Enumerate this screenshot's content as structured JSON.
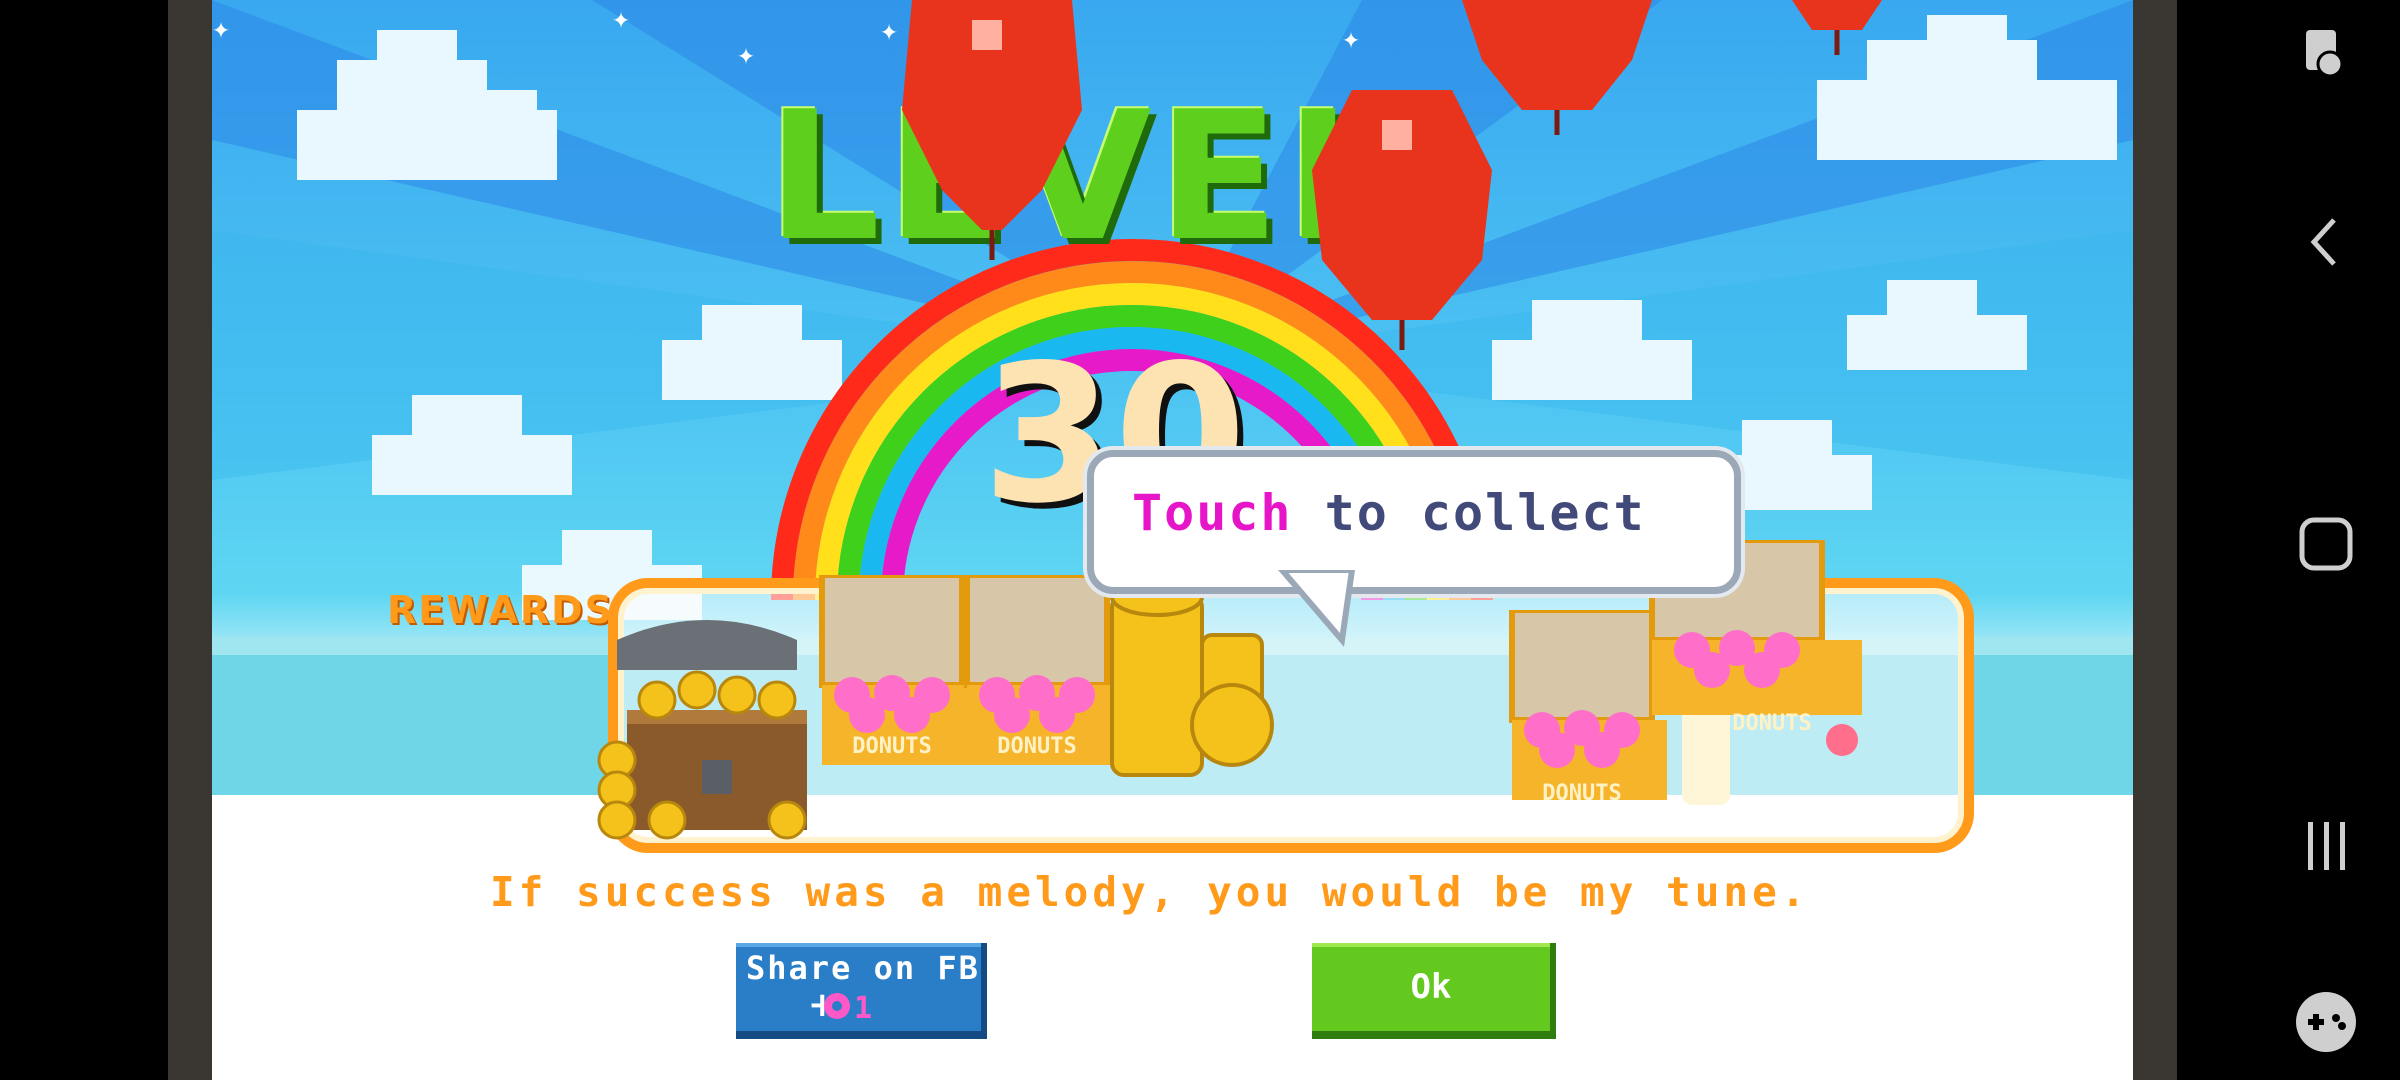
{
  "game": {
    "level_title": "LEVEL",
    "level_number": "30",
    "rewards_label": "REWARDS",
    "bubble": {
      "highlight": "Touch",
      "rest": " to collect"
    },
    "donut_box_label": "DONUTS",
    "quote": "If success was a melody, you would be my tune.",
    "share_button": {
      "label": "Share on FB",
      "plus": "+",
      "cost": "1",
      "icon": "donut-icon"
    },
    "ok_button": {
      "label": "Ok"
    },
    "colors": {
      "orange": "#ff9a1a",
      "green": "#63c91f",
      "blue": "#2a7ec8",
      "pink": "#e616c8",
      "sky": "#4dc3f2"
    }
  },
  "system_nav": {
    "icons": [
      "screen-assistant-icon",
      "back-icon",
      "home-icon",
      "recents-icon",
      "game-launcher-icon"
    ]
  }
}
